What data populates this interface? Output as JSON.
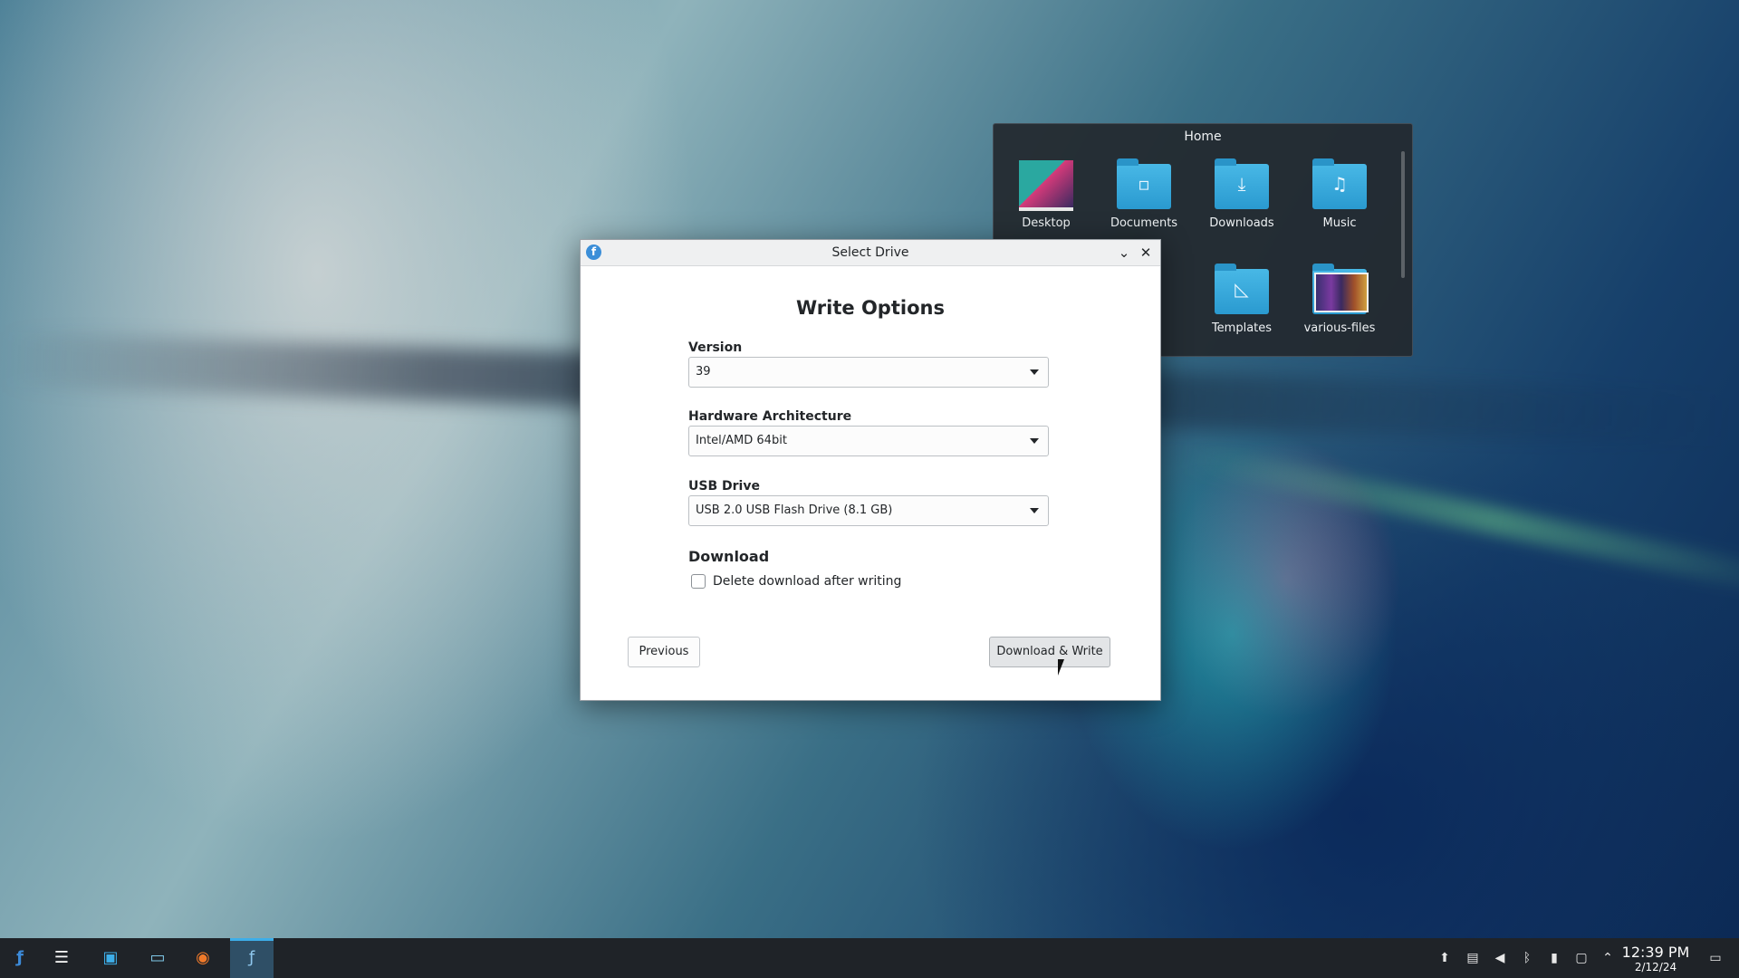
{
  "folder_view": {
    "title": "Home",
    "items": [
      {
        "label": "Desktop",
        "icon": "desktop-thumbnail-icon"
      },
      {
        "label": "Documents",
        "icon": "documents-folder-icon"
      },
      {
        "label": "Downloads",
        "icon": "downloads-folder-icon"
      },
      {
        "label": "Music",
        "icon": "music-folder-icon"
      },
      {
        "label": "Templates",
        "icon": "templates-folder-icon"
      },
      {
        "label": "various-files",
        "icon": "various-files-folder-icon"
      }
    ]
  },
  "dialog": {
    "title": "Select Drive",
    "heading": "Write Options",
    "version": {
      "label": "Version",
      "value": "39"
    },
    "architecture": {
      "label": "Hardware Architecture",
      "value": "Intel/AMD 64bit"
    },
    "usb_drive": {
      "label": "USB Drive",
      "value": "USB 2.0 USB Flash Drive (8.1 GB)"
    },
    "download": {
      "heading": "Download",
      "delete_after_label": "Delete download after writing",
      "delete_after_checked": false
    },
    "buttons": {
      "previous": "Previous",
      "download_write": "Download & Write"
    }
  },
  "taskbar": {
    "clock_time": "12:39 PM",
    "clock_date": "2/12/24",
    "colors": {
      "background": "#1f2328",
      "accent": "#3daee9"
    }
  }
}
